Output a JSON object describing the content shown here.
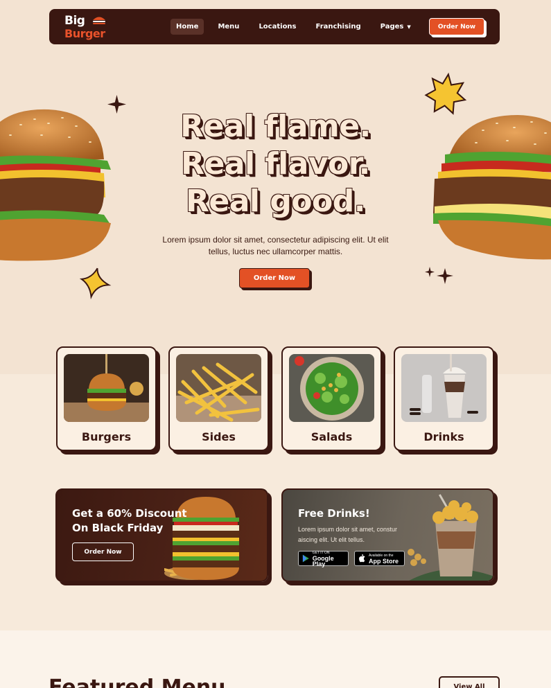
{
  "nav": {
    "logo_top": "Big",
    "logo_bottom": "Burger",
    "links": [
      "Home",
      "Menu",
      "Locations",
      "Franchising",
      "Pages"
    ],
    "order_label": "Order Now"
  },
  "hero": {
    "title_lines": [
      "Real flame.",
      "Real flavor.",
      "Real good."
    ],
    "subtitle": "Lorem ipsum dolor sit amet, consectetur adipiscing elit. Ut elit tellus, luctus nec ullamcorper mattis.",
    "order_label": "Order Now"
  },
  "categories": [
    "Burgers",
    "Sides",
    "Salads",
    "Drinks"
  ],
  "promos": {
    "discount": {
      "title": "Get a 60% Discount On Black Friday",
      "button": "Order Now"
    },
    "drinks": {
      "title": "Free Drinks!",
      "text": "Lorem ipsum dolor sit amet, constur aiscing elit. Ut elit tellus.",
      "google_small": "GET IT ON",
      "google_big": "Google Play",
      "apple_small": "Available on the",
      "apple_big": "App Store"
    }
  },
  "featured": {
    "title": "Featured Menu",
    "view_all": "View All"
  },
  "colors": {
    "brand_dark": "#3a1711",
    "accent": "#e35125",
    "background": "#f3e3d2"
  }
}
